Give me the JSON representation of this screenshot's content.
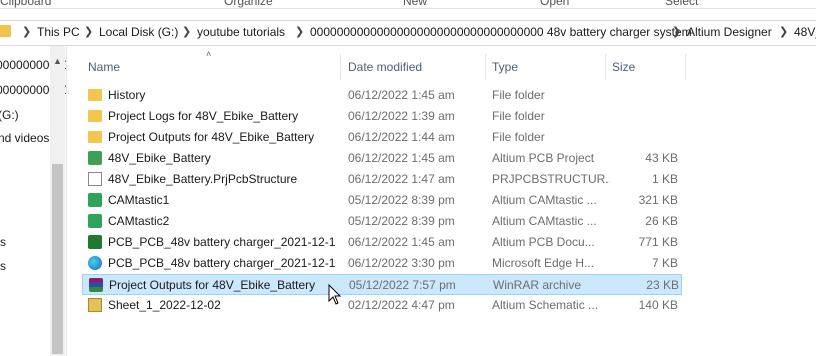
{
  "ribbon": {
    "groups": [
      "Clipboard",
      "Organize",
      "New",
      "Open",
      "Select"
    ]
  },
  "address_bar": {
    "crumbs": [
      "This PC",
      "Local Disk (G:)",
      "youtube tutorials",
      "00000000000000000000000000000000000 48v battery charger system",
      "Altium Designer",
      "48V_"
    ]
  },
  "nav_pane": {
    "items": [
      "00000000000",
      "00000000000",
      "(G:)",
      "nd videos",
      "s",
      "s"
    ]
  },
  "columns": {
    "name": "Name",
    "date": "Date modified",
    "type": "Type",
    "size": "Size"
  },
  "files": [
    {
      "name": "History",
      "date": "06/12/2022 1:45 am",
      "type": "File folder",
      "size": "",
      "icon": "folder-icon"
    },
    {
      "name": "Project Logs for 48V_Ebike_Battery",
      "date": "06/12/2022 1:39 am",
      "type": "File folder",
      "size": "",
      "icon": "folder-icon"
    },
    {
      "name": "Project Outputs for 48V_Ebike_Battery",
      "date": "06/12/2022 1:44 am",
      "type": "File folder",
      "size": "",
      "icon": "folder-icon"
    },
    {
      "name": "48V_Ebike_Battery",
      "date": "06/12/2022 1:45 am",
      "type": "Altium PCB Project",
      "size": "43 KB",
      "icon": "altium-project-icon"
    },
    {
      "name": "48V_Ebike_Battery.PrjPcbStructure",
      "date": "06/12/2022 1:47 am",
      "type": "PRJPCBSTRUCTUR...",
      "size": "1 KB",
      "icon": "document-icon"
    },
    {
      "name": "CAMtastic1",
      "date": "05/12/2022 8:39 pm",
      "type": "Altium CAMtastic ...",
      "size": "321 KB",
      "icon": "camtastic-icon"
    },
    {
      "name": "CAMtastic2",
      "date": "05/12/2022 8:39 pm",
      "type": "Altium CAMtastic ...",
      "size": "26 KB",
      "icon": "camtastic-icon"
    },
    {
      "name": "PCB_PCB_48v battery charger_2021-12-1...",
      "date": "06/12/2022 1:45 am",
      "type": "Altium PCB Docu...",
      "size": "771 KB",
      "icon": "pcb-document-icon"
    },
    {
      "name": "PCB_PCB_48v battery charger_2021-12-1...",
      "date": "06/12/2022 3:30 pm",
      "type": "Microsoft Edge H...",
      "size": "7 KB",
      "icon": "edge-icon"
    },
    {
      "name": "Project Outputs for 48V_Ebike_Battery",
      "date": "05/12/2022 7:57 pm",
      "type": "WinRAR archive",
      "size": "23 KB",
      "icon": "winrar-icon",
      "selected": true
    },
    {
      "name": "Sheet_1_2022-12-02",
      "date": "02/12/2022 4:47 pm",
      "type": "Altium Schematic ...",
      "size": "140 KB",
      "icon": "schematic-icon"
    }
  ]
}
